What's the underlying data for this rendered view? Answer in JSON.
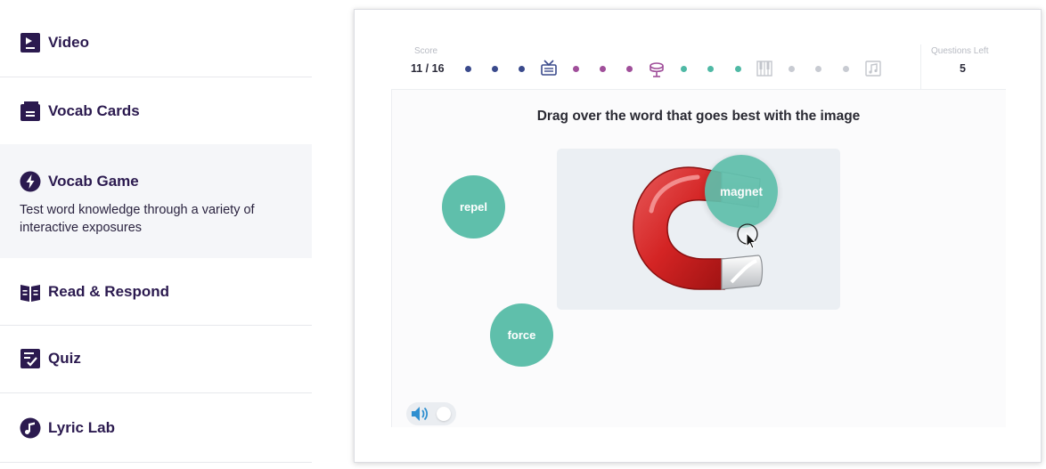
{
  "sidebar": {
    "items": [
      {
        "label": "Video",
        "icon": "video-icon"
      },
      {
        "label": "Vocab Cards",
        "icon": "cards-icon"
      },
      {
        "label": "Vocab Game",
        "icon": "bolt-icon",
        "description": "Test word knowledge through a variety of interactive exposures",
        "active": true
      },
      {
        "label": "Read & Respond",
        "icon": "book-icon"
      },
      {
        "label": "Quiz",
        "icon": "checklist-icon"
      },
      {
        "label": "Lyric Lab",
        "icon": "music-note-icon"
      }
    ]
  },
  "game": {
    "score_label": "Score",
    "score_value": "11 / 16",
    "questions_left_label": "Questions Left",
    "questions_left_value": "5",
    "progress": [
      {
        "type": "dot",
        "color": "#3a4a8c"
      },
      {
        "type": "dot",
        "color": "#3a4a8c"
      },
      {
        "type": "dot",
        "color": "#3a4a8c"
      },
      {
        "type": "milestone",
        "icon": "radio-icon",
        "color": "#3a4a8c"
      },
      {
        "type": "dot",
        "color": "#a04f9a"
      },
      {
        "type": "dot",
        "color": "#a04f9a"
      },
      {
        "type": "dot",
        "color": "#a04f9a"
      },
      {
        "type": "milestone",
        "icon": "drum-icon",
        "color": "#a04f9a"
      },
      {
        "type": "dot",
        "color": "#4fb9a5"
      },
      {
        "type": "dot",
        "color": "#4fb9a5"
      },
      {
        "type": "dot",
        "color": "#4fb9a5"
      },
      {
        "type": "milestone",
        "icon": "piano-icon",
        "color": "#c3c6cc"
      },
      {
        "type": "dot",
        "color": "#c8cbd2"
      },
      {
        "type": "dot",
        "color": "#c8cbd2"
      },
      {
        "type": "dot",
        "color": "#c8cbd2"
      },
      {
        "type": "milestone",
        "icon": "music-sheet-icon",
        "color": "#c3c6cc"
      }
    ],
    "prompt": "Drag over the word that goes best with the image",
    "image_subject": "magnet-image",
    "words": [
      "repel",
      "force",
      "magnet"
    ],
    "bubble_color": "#5fbfab",
    "audio_icon": "speaker-icon"
  }
}
